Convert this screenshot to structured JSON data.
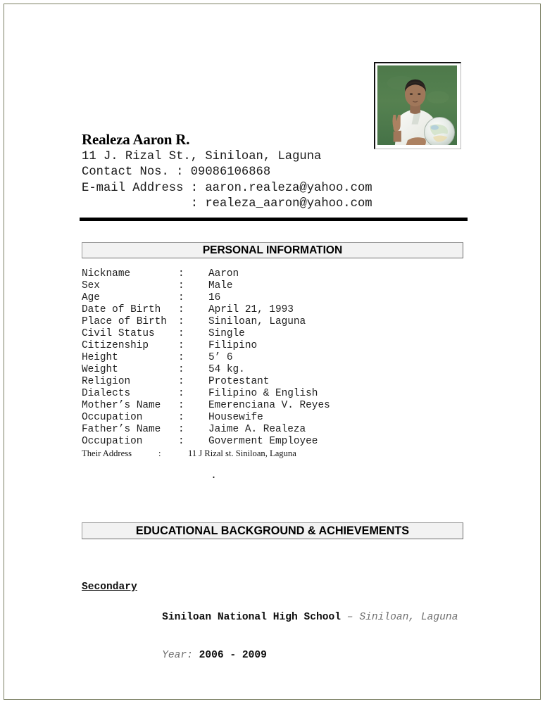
{
  "document": {
    "type": "resume",
    "page_background": "#ffffff",
    "page_border_color": "#7b7f63",
    "rule_color": "#000000"
  },
  "photo": {
    "alt": "photo-of-applicant",
    "description": "young man in white shirt holding a globe in front of a green chalkboard",
    "border_color": "#111111",
    "background_color": "#3f7040"
  },
  "header": {
    "full_name": "Realeza Aaron R.",
    "address_line": "11 J. Rizal St., Siniloan, Laguna",
    "contact_line": "Contact Nos. : 09086106868",
    "email_line_1": "E-mail Address : aaron.realeza@yahoo.com",
    "email_line_2": "               : realeza_aaron@yahoo.com"
  },
  "sections": {
    "personal_heading": "PERSONAL INFORMATION",
    "education_heading": "EDUCATIONAL BACKGROUND & ACHIEVEMENTS"
  },
  "personal_info": {
    "separator": ":",
    "rows": [
      {
        "label": "Nickname",
        "value": "Aaron"
      },
      {
        "label": "Sex",
        "value": "Male"
      },
      {
        "label": "Age",
        "value": "16"
      },
      {
        "label": "Date of Birth",
        "value": "April 21, 1993"
      },
      {
        "label": "Place of Birth",
        "value": "Siniloan, Laguna"
      },
      {
        "label": "Civil Status",
        "value": "Single"
      },
      {
        "label": "Citizenship",
        "value": "Filipino"
      },
      {
        "label": "Height",
        "value": "5’ 6"
      },
      {
        "label": "Weight",
        "value": "54 kg."
      },
      {
        "label": "Religion",
        "value": "Protestant"
      },
      {
        "label": "Dialects",
        "value": "Filipino & English"
      },
      {
        "label": "Mother’s Name",
        "value": "Emerenciana V. Reyes"
      },
      {
        "label": "Occupation",
        "value": "Housewife"
      },
      {
        "label": "Father’s Name",
        "value": "Jaime A. Realeza"
      },
      {
        "label": "Occupation",
        "value": "Goverment Employee"
      }
    ],
    "address_row": {
      "label": "Their Address",
      "value": "11 J Rizal st. Siniloan, Laguna"
    },
    "stray_mark": "."
  },
  "education": {
    "level_label": "Secondary",
    "school_name": "Siniloan National High School",
    "school_separator": " – ",
    "school_location": "Siniloan, Laguna",
    "year_label": "Year: ",
    "year_value": "2006 - 2009"
  }
}
